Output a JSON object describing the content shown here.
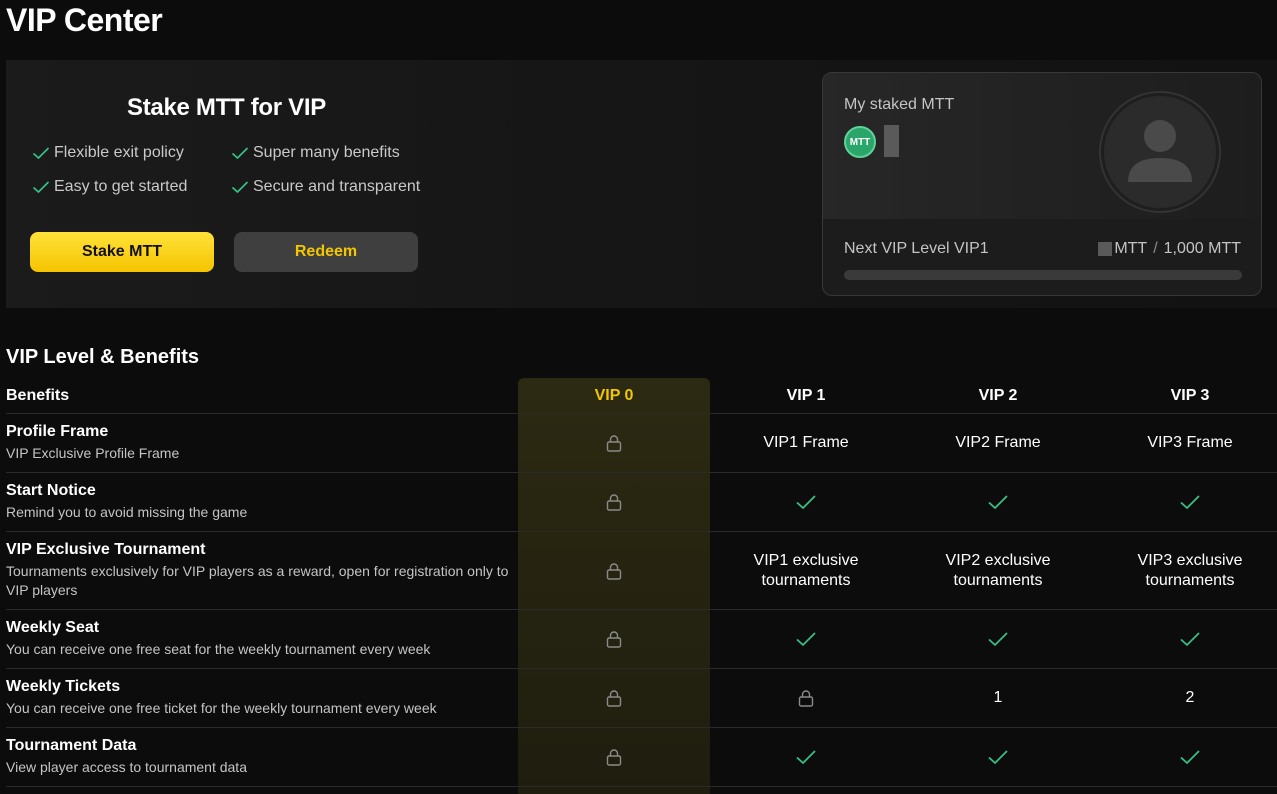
{
  "page": {
    "title": "VIP Center"
  },
  "stake": {
    "title": "Stake MTT for VIP",
    "features": [
      "Flexible exit policy",
      "Super many benefits",
      "Easy to get started",
      "Secure and transparent"
    ],
    "stake_button": "Stake MTT",
    "redeem_button": "Redeem"
  },
  "card": {
    "label": "My staked MTT",
    "token_logo": "MTT",
    "next_level": "Next VIP Level VIP1",
    "current_unit": "MTT",
    "separator": "/",
    "target": "1,000 MTT",
    "progress_fraction": 0
  },
  "benefits": {
    "title": "VIP Level & Benefits",
    "header": {
      "label": "Benefits",
      "levels": [
        "VIP 0",
        "VIP 1",
        "VIP 2",
        "VIP 3"
      ],
      "active_index": 0
    },
    "rows": [
      {
        "name": "Profile Frame",
        "desc": "VIP Exclusive Profile Frame",
        "values": [
          "lock",
          "VIP1 Frame",
          "VIP2 Frame",
          "VIP3 Frame"
        ]
      },
      {
        "name": "Start Notice",
        "desc": "Remind you to avoid missing the game",
        "values": [
          "lock",
          "check",
          "check",
          "check"
        ]
      },
      {
        "name": "VIP Exclusive Tournament",
        "desc": "Tournaments exclusively for VIP players as a reward, open for registration only to VIP players",
        "values": [
          "lock",
          "VIP1 exclusive tournaments",
          "VIP2 exclusive tournaments",
          "VIP3 exclusive tournaments"
        ]
      },
      {
        "name": "Weekly Seat",
        "desc": "You can receive one free seat for the weekly tournament every week",
        "values": [
          "lock",
          "check",
          "check",
          "check"
        ]
      },
      {
        "name": "Weekly Tickets",
        "desc": "You can receive one free ticket for the weekly tournament every week",
        "values": [
          "lock",
          "lock",
          "1",
          "2"
        ]
      },
      {
        "name": "Tournament Data",
        "desc": "View player access to tournament data",
        "values": [
          "lock",
          "check",
          "check",
          "check"
        ]
      }
    ]
  },
  "colors": {
    "accent": "#f4c600",
    "check": "#35c58a",
    "lock": "#8a8a8a"
  }
}
